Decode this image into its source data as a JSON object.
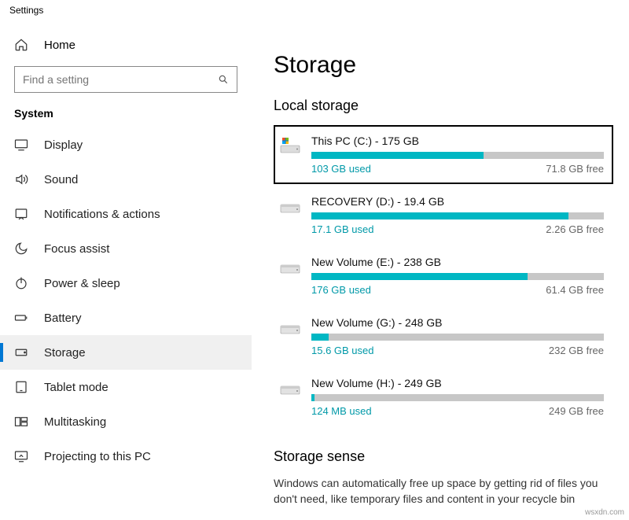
{
  "window_title": "Settings",
  "home_label": "Home",
  "search_placeholder": "Find a setting",
  "section_label": "System",
  "nav": [
    {
      "label": "Display"
    },
    {
      "label": "Sound"
    },
    {
      "label": "Notifications & actions"
    },
    {
      "label": "Focus assist"
    },
    {
      "label": "Power & sleep"
    },
    {
      "label": "Battery"
    },
    {
      "label": "Storage"
    },
    {
      "label": "Tablet mode"
    },
    {
      "label": "Multitasking"
    },
    {
      "label": "Projecting to this PC"
    }
  ],
  "page_title": "Storage",
  "local_storage_label": "Local storage",
  "drives": [
    {
      "title": "This PC (C:) - 175 GB",
      "used": "103 GB used",
      "free": "71.8 GB free",
      "pct": 59
    },
    {
      "title": "RECOVERY (D:) - 19.4 GB",
      "used": "17.1 GB used",
      "free": "2.26 GB free",
      "pct": 88
    },
    {
      "title": "New Volume (E:) - 238 GB",
      "used": "176 GB used",
      "free": "61.4 GB free",
      "pct": 74
    },
    {
      "title": "New Volume (G:) - 248 GB",
      "used": "15.6 GB used",
      "free": "232 GB free",
      "pct": 6
    },
    {
      "title": "New Volume (H:) - 249 GB",
      "used": "124 MB used",
      "free": "249 GB free",
      "pct": 1
    }
  ],
  "storage_sense_title": "Storage sense",
  "storage_sense_desc": "Windows can automatically free up space by getting rid of files you don't need, like temporary files and content in your recycle bin",
  "watermark": "wsxdn.com"
}
